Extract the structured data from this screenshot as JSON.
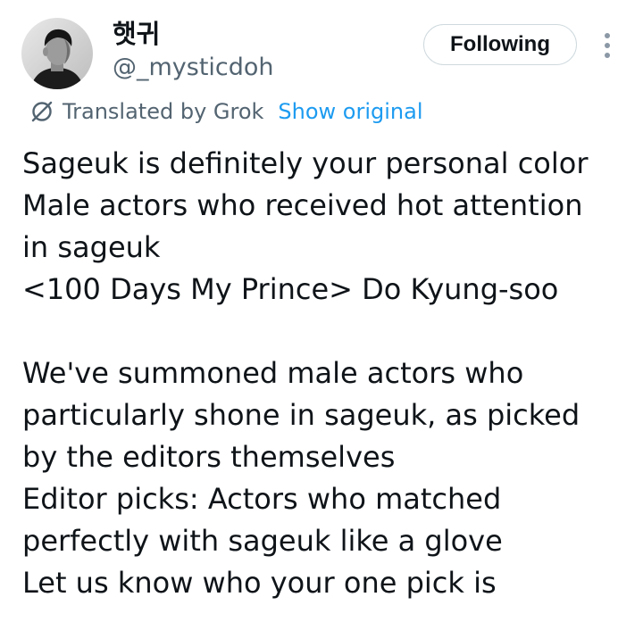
{
  "author": {
    "display_name": "햇귀",
    "handle": "@_mysticdoh"
  },
  "follow_button": {
    "label": "Following"
  },
  "icons": {
    "more": "more-vertical-icon",
    "translate": "grok-icon"
  },
  "translation": {
    "label": "Translated by Grok",
    "show_original_label": "Show original"
  },
  "tweet": {
    "lines": [
      "Sageuk is definitely your personal color",
      "Male actors who received hot attention",
      "in sageuk",
      "<100 Days My Prince> Do Kyung-soo",
      "",
      "We've summoned male actors who",
      "particularly shone in sageuk, as picked",
      "by the editors themselves",
      "Editor picks: Actors who matched",
      "perfectly with sageuk like a glove",
      "Let us know who your one pick is"
    ]
  },
  "colors": {
    "text_primary": "#0f1419",
    "text_secondary": "#536471",
    "link": "#1d9bf0",
    "button_border": "#cfd9de"
  }
}
